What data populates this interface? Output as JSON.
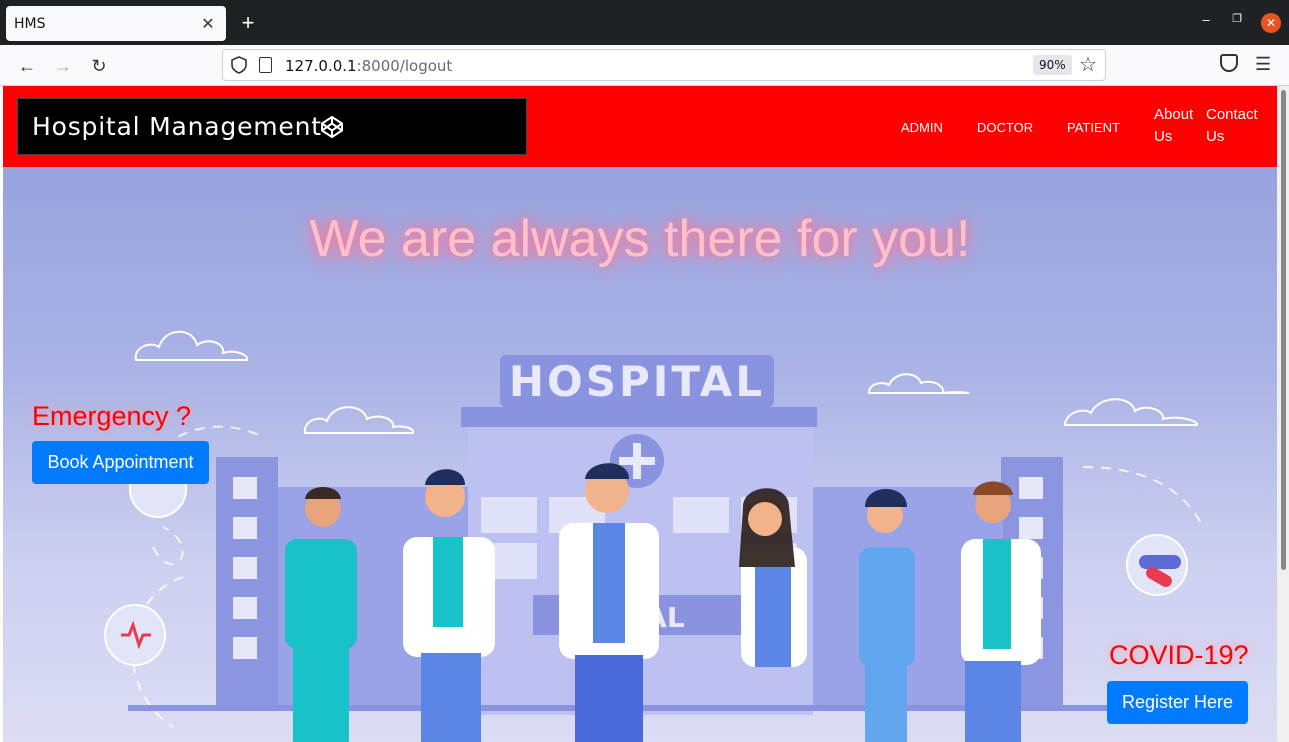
{
  "browser": {
    "tab_title": "HMS",
    "tab_close": "✕",
    "new_tab": "+",
    "url_host": "127.0.0.1",
    "url_rest": ":8000/logout",
    "zoom": "90%",
    "icons": [
      "back-arrow-icon",
      "forward-arrow-icon",
      "reload-icon",
      "shield-icon",
      "page-icon",
      "star-icon",
      "pocket-icon",
      "hamburger-menu-icon"
    ]
  },
  "header": {
    "brand": "Hospital Management",
    "nav": {
      "admin": "ADMIN",
      "doctor": "DOCTOR",
      "patient": "PATIENT",
      "about_1": "About",
      "about_2": "Us",
      "contact_1": "Contact",
      "contact_2": "Us"
    },
    "color": "#ff0000"
  },
  "hero": {
    "title": "We are always there for you!",
    "building_sign": "HOSPITAL",
    "building_sign_lower": "PITAL",
    "emergency_text": "Emergency ?",
    "book_button": "Book Appointment",
    "covid_text": "COVID-19?",
    "register_button": "Register Here",
    "button_color": "#007bff"
  }
}
